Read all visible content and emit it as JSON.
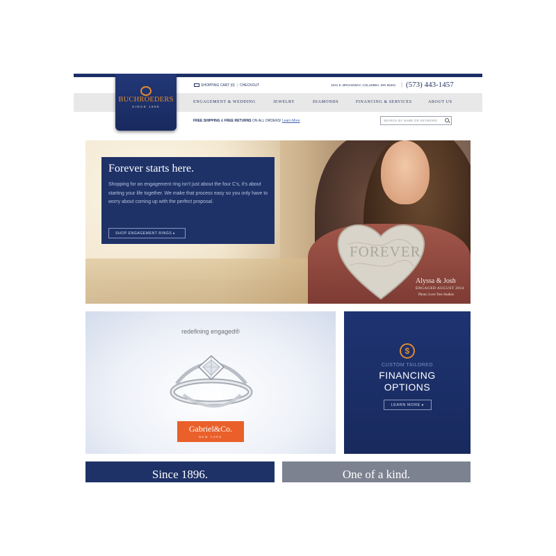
{
  "brand": {
    "name": "BUCHROEDERS",
    "since": "SINCE 1896",
    "colors": {
      "navy": "#1e3268",
      "accent": "#e28a2c",
      "gray": "#7c8290"
    }
  },
  "utility": {
    "cart_label": "SHOPPING CART (0)",
    "checkout_label": "CHECKOUT",
    "address": "1021 E. BROADWAY, COLUMBIA, MO 65201",
    "phone": "(573) 443-1457"
  },
  "nav": {
    "items": [
      {
        "label": "ENGAGEMENT & WEDDING"
      },
      {
        "label": "JEWELRY"
      },
      {
        "label": "DIAMONDS"
      },
      {
        "label": "FINANCING & SERVICES"
      },
      {
        "label": "ABOUT US"
      }
    ]
  },
  "promo_bar": {
    "shipping": "FREE SHIPPING",
    "amp": " & ",
    "returns": "FREE RETURNS",
    "rest": " ON ALL ORDERS! ",
    "link": "Learn More"
  },
  "search": {
    "placeholder": "SEARCH BY NAME OR KEYWORD",
    "icon": "search-icon"
  },
  "hero": {
    "title": "Forever starts here.",
    "body": "Shopping for an engagement ring isn't just about the four C's, it's about starting your life together. We make that process easy so you only have to worry about coming up with the perfect proposal.",
    "button": "SHOP ENGAGEMENT RINGS ▸",
    "heart_text": "FOREVER",
    "credit_names": "Alyssa & Josh",
    "credit_date": "ENGAGED AUGUST 2014",
    "credit_photo": "Photo: Love Tree Studios"
  },
  "ring_promo": {
    "tagline": "redefining engaged®",
    "brand_name": "Gabriel&Co.",
    "brand_city": "NEW YORK"
  },
  "finance_promo": {
    "icon": "dollar-coin-icon",
    "subtitle": "CUSTOM TAILORED",
    "title_line1": "FINANCING",
    "title_line2": "OPTIONS",
    "button": "LEARN MORE ▸"
  },
  "bottom": {
    "left": "Since 1896.",
    "right": "One of a kind."
  }
}
